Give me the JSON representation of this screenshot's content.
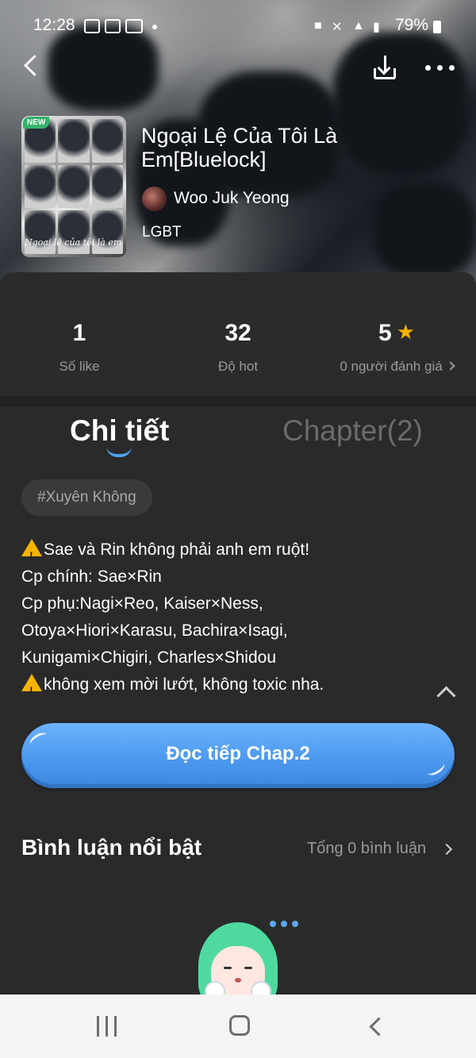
{
  "status_bar": {
    "time": "12:28",
    "battery": "79%",
    "icons": [
      "gallery-icon",
      "shopee-icon",
      "baomoi-icon",
      "dot-icon",
      "alarm-icon",
      "mute-icon",
      "wifi-icon",
      "signal-icon",
      "battery-icon"
    ]
  },
  "toolbar": {
    "back_icon": "back-arrow-icon",
    "download_icon": "download-icon",
    "more_icon": "more-icon"
  },
  "story": {
    "badge": "NEW",
    "cover_caption": "Ngoại lệ của tôi là em",
    "title": "Ngoại Lệ Của Tôi Là Em[Bluelock]",
    "author": "Woo Juk Yeong",
    "genre": "LGBT"
  },
  "stats": {
    "likes": {
      "value": "1",
      "label": "Số like"
    },
    "hot": {
      "value": "32",
      "label": "Độ hot"
    },
    "rating": {
      "value": "5",
      "label": "0 người đánh giá"
    }
  },
  "tabs": {
    "detail": "Chi tiết",
    "chapter": "Chapter(2)"
  },
  "tag": "#Xuyên Không",
  "description": {
    "line1": "Sae và Rin không phải anh em ruột!",
    "line2": "Cp chính: Sae×Rin",
    "line3": "Cp phụ:Nagi×Reo, Kaiser×Ness,",
    "line4": "Otoya×Hiori×Karasu, Bachira×Isagi,",
    "line5": "Kunigami×Chigiri, Charles×Shidou",
    "line6": "không xem mời lướt, không toxic nha."
  },
  "read_button": "Đọc tiếp Chap.2",
  "comments": {
    "title": "Bình luận nổi bật",
    "total": "Tổng 0 bình luận"
  },
  "colors": {
    "accent": "#4a97ee",
    "background": "#2a2a2a",
    "star": "#f5b301",
    "badge": "#34b36a",
    "mascot_hair": "#4fd9a0"
  }
}
